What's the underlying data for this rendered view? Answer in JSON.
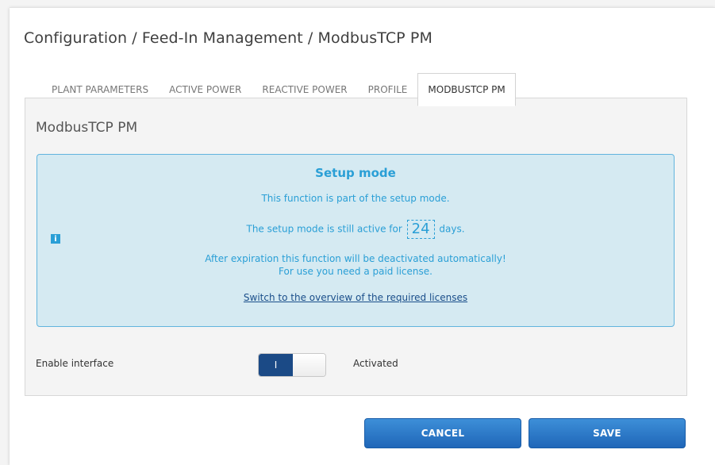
{
  "breadcrumb": "Configuration / Feed-In Management / ModbusTCP PM",
  "tabs": [
    {
      "label": "PLANT PARAMETERS",
      "active": false
    },
    {
      "label": "ACTIVE POWER",
      "active": false
    },
    {
      "label": "REACTIVE POWER",
      "active": false
    },
    {
      "label": "PROFILE",
      "active": false
    },
    {
      "label": "MODBUSTCP PM",
      "active": true
    }
  ],
  "panel": {
    "title": "ModbusTCP PM",
    "info": {
      "icon": "info-icon",
      "icon_glyph": "i",
      "setup_title": "Setup mode",
      "line1": "This function is part of the setup mode.",
      "line2_prefix": "The setup mode is still active for",
      "days": "24",
      "line2_suffix": "days.",
      "line3a": "After expiration this function will be deactivated automatically!",
      "line3b": "For use you need a paid license.",
      "link": "Switch to the overview of the required licenses"
    },
    "enable": {
      "label": "Enable interface",
      "toggle_on_label": "I",
      "state": "Activated"
    }
  },
  "buttons": {
    "cancel": "CANCEL",
    "save": "SAVE"
  },
  "colors": {
    "accent": "#2a9fd6",
    "info_bg": "#d5eaf2",
    "button": "#2b7bcc",
    "toggle_on": "#1b4a86"
  }
}
